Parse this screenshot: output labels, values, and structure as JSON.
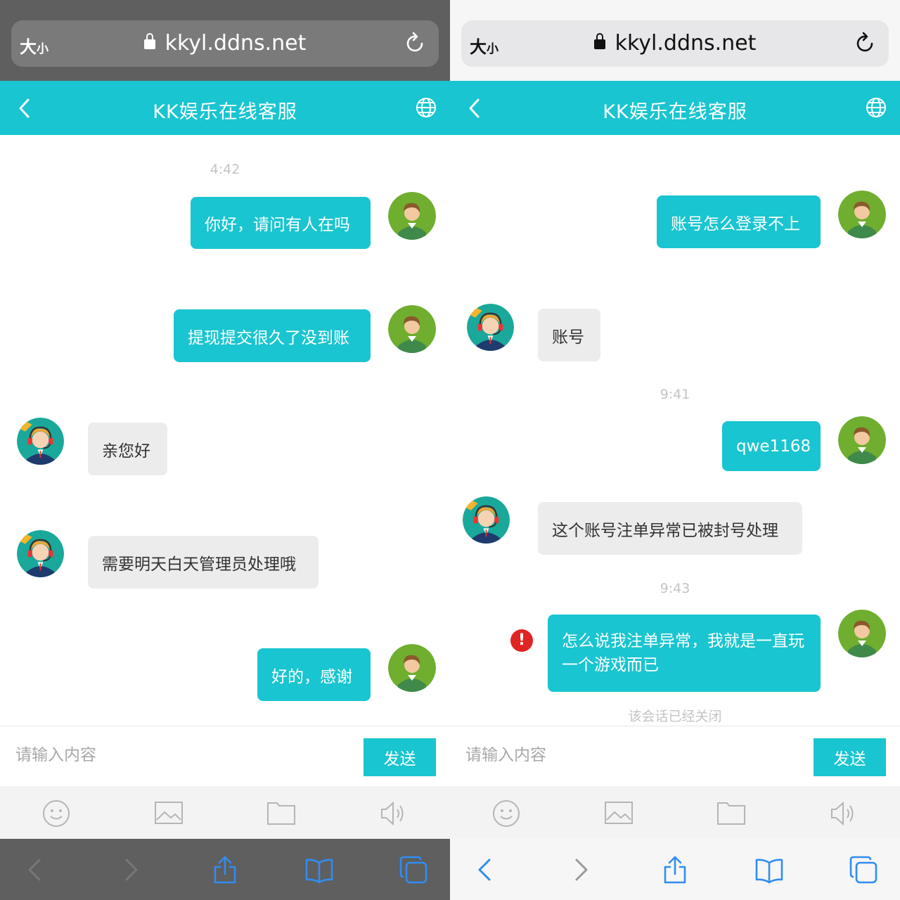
{
  "colors": {
    "accent": "#19c5d0",
    "bubble_in": "#ececec",
    "error": "#e02323"
  },
  "panels": [
    {
      "browser": {
        "text_size_label": "大",
        "text_size_small": "小",
        "url": "kkyl.ddns.net"
      },
      "header": {
        "title": "KK娱乐在线客服"
      },
      "timestamps": [
        "4:42"
      ],
      "messages": [
        {
          "direction": "out",
          "text": "你好，请问有人在吗"
        },
        {
          "direction": "out",
          "text": "提现提交很久了没到账"
        },
        {
          "direction": "in",
          "text": "亲您好"
        },
        {
          "direction": "in",
          "text": "需要明天白天管理员处理哦"
        },
        {
          "direction": "out",
          "text": "好的，感谢"
        }
      ],
      "composer": {
        "placeholder": "请输入内容",
        "send_label": "发送"
      },
      "toolbar_icons": [
        "smiley-icon",
        "image-icon",
        "folder-icon",
        "speaker-icon"
      ],
      "safari_nav_icons": [
        "back-icon",
        "forward-icon",
        "share-icon",
        "bookmarks-icon",
        "tabs-icon"
      ]
    },
    {
      "browser": {
        "text_size_label": "大",
        "text_size_small": "小",
        "url": "kkyl.ddns.net"
      },
      "header": {
        "title": "KK娱乐在线客服"
      },
      "timestamps": [
        "9:41",
        "9:43"
      ],
      "messages": [
        {
          "direction": "out",
          "text": "账号怎么登录不上"
        },
        {
          "direction": "in",
          "text": "账号"
        },
        {
          "direction": "out",
          "text": "qwe1168"
        },
        {
          "direction": "in",
          "text": "这个账号注单异常已被封号处理"
        },
        {
          "direction": "out",
          "text": "怎么说我注单异常，我就是一直玩一个游戏而已",
          "failed": true,
          "error_glyph": "!"
        }
      ],
      "session_closed": "该会话已经关闭",
      "composer": {
        "placeholder": "请输入内容",
        "send_label": "发送"
      },
      "toolbar_icons": [
        "smiley-icon",
        "image-icon",
        "folder-icon",
        "speaker-icon"
      ],
      "safari_nav_icons": [
        "back-icon",
        "forward-icon",
        "share-icon",
        "bookmarks-icon",
        "tabs-icon"
      ]
    }
  ]
}
